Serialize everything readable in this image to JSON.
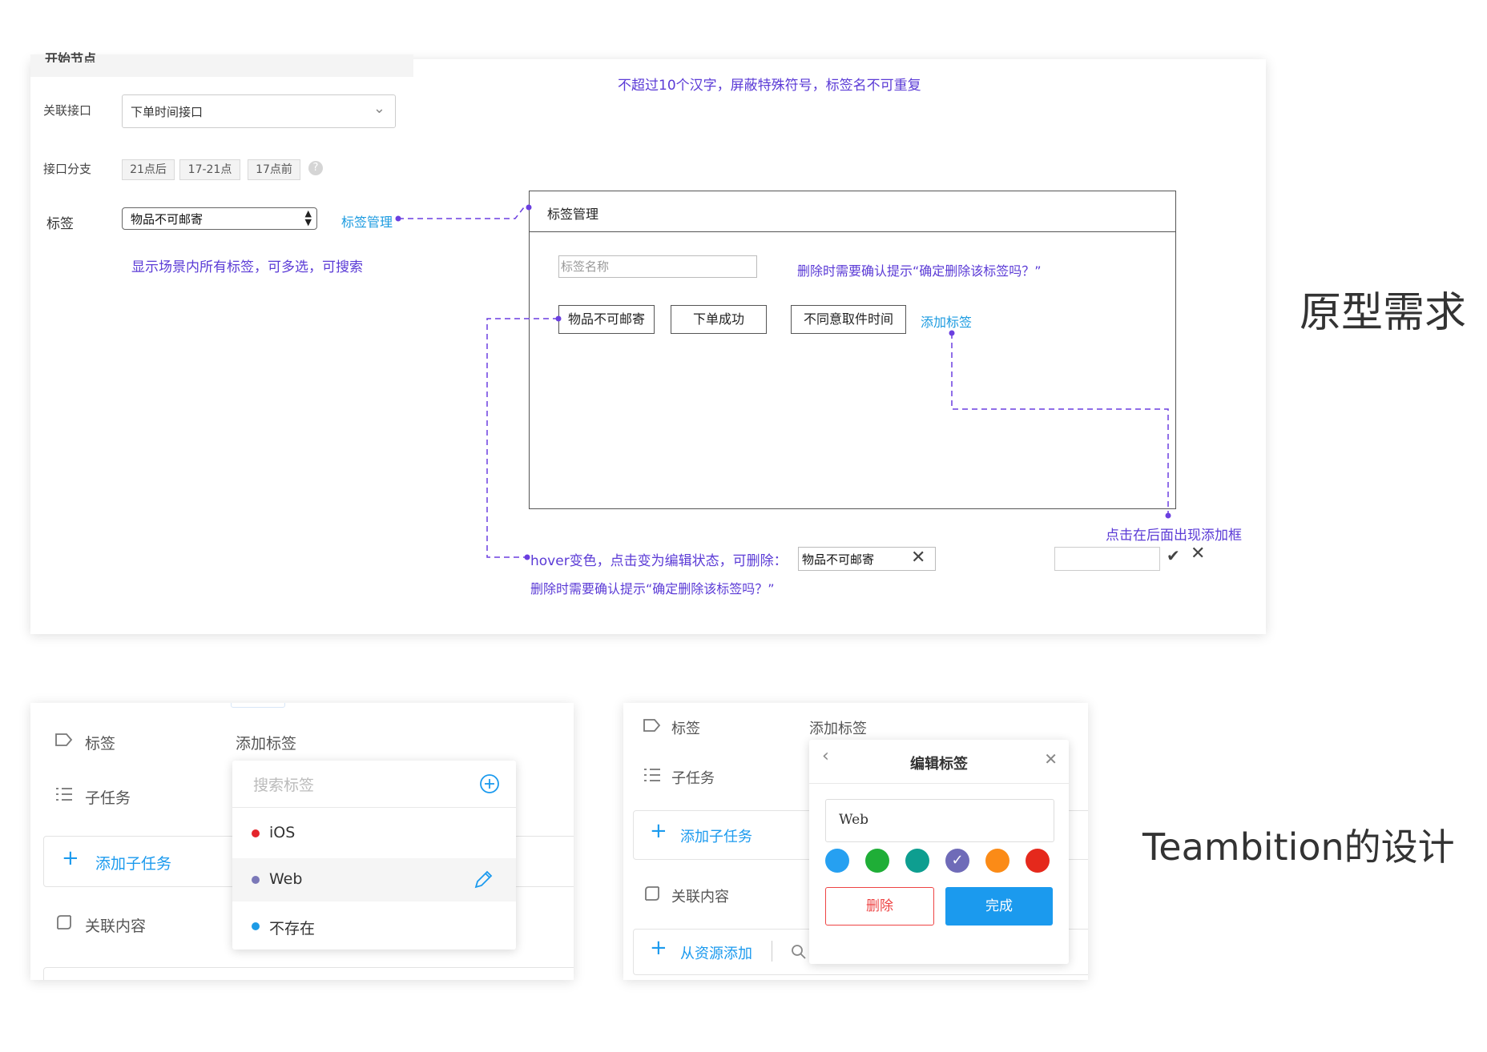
{
  "prototype": {
    "cut_header": "开始节点",
    "fields": {
      "interface_label": "关联接口",
      "interface_value": "下单时间接口",
      "branch_label": "接口分支",
      "branches": [
        "21点后",
        "17-21点",
        "17点前"
      ],
      "tag_label": "标签",
      "tag_value": "物品不可邮寄",
      "tag_manage_link": "标签管理"
    },
    "notes": {
      "top": "不超过10个汉字，屏蔽特殊符号，标签名不可重复",
      "scene": "显示场景内所有标签，可多选，可搜索",
      "delete_confirm_1": "删除时需要确认提示“确定删除该标签吗？”",
      "hover": "hover变色，点击变为编辑状态，可删除：",
      "delete_confirm_2": "删除时需要确认提示“确定删除该标签吗？”",
      "click_add": "点击在后面出现添加框"
    },
    "dialog": {
      "title": "标签管理",
      "name_placeholder": "标签名称",
      "tags": [
        "物品不可邮寄",
        "下单成功",
        "不同意取件时间"
      ],
      "add_link": "添加标签"
    },
    "edit_example": {
      "value": "物品不可邮寄",
      "close_glyph": "✕"
    },
    "add_example": {
      "confirm_glyph": "✔",
      "cancel_glyph": "✕"
    },
    "side_label": "原型需求"
  },
  "teambition_left": {
    "rows": {
      "tag": "标签",
      "subtask": "子任务",
      "add_subtask": "添加子任务",
      "related": "关联内容"
    },
    "add_tag_label": "添加标签",
    "dropdown": {
      "search_placeholder": "搜索标签",
      "items": [
        {
          "label": "iOS",
          "color": "#e4252c"
        },
        {
          "label": "Web",
          "color": "#7b78b8"
        },
        {
          "label": "不存在",
          "color": "#1d9be6"
        }
      ]
    }
  },
  "teambition_right": {
    "rows": {
      "tag": "标签",
      "subtask": "子任务",
      "add_subtask": "添加子任务",
      "related": "关联内容",
      "add_from_resource": "从资源添加"
    },
    "add_tag_label": "添加标签",
    "edit_popup": {
      "title": "编辑标签",
      "input_value": "Web",
      "colors": [
        "#26a0f1",
        "#1fae37",
        "#0e9e90",
        "#6f6bb8",
        "#fb8b17",
        "#e5291c"
      ],
      "selected_color_index": 3,
      "delete_label": "删除",
      "done_label": "完成"
    }
  },
  "side_label_2": "Teambition的设计"
}
